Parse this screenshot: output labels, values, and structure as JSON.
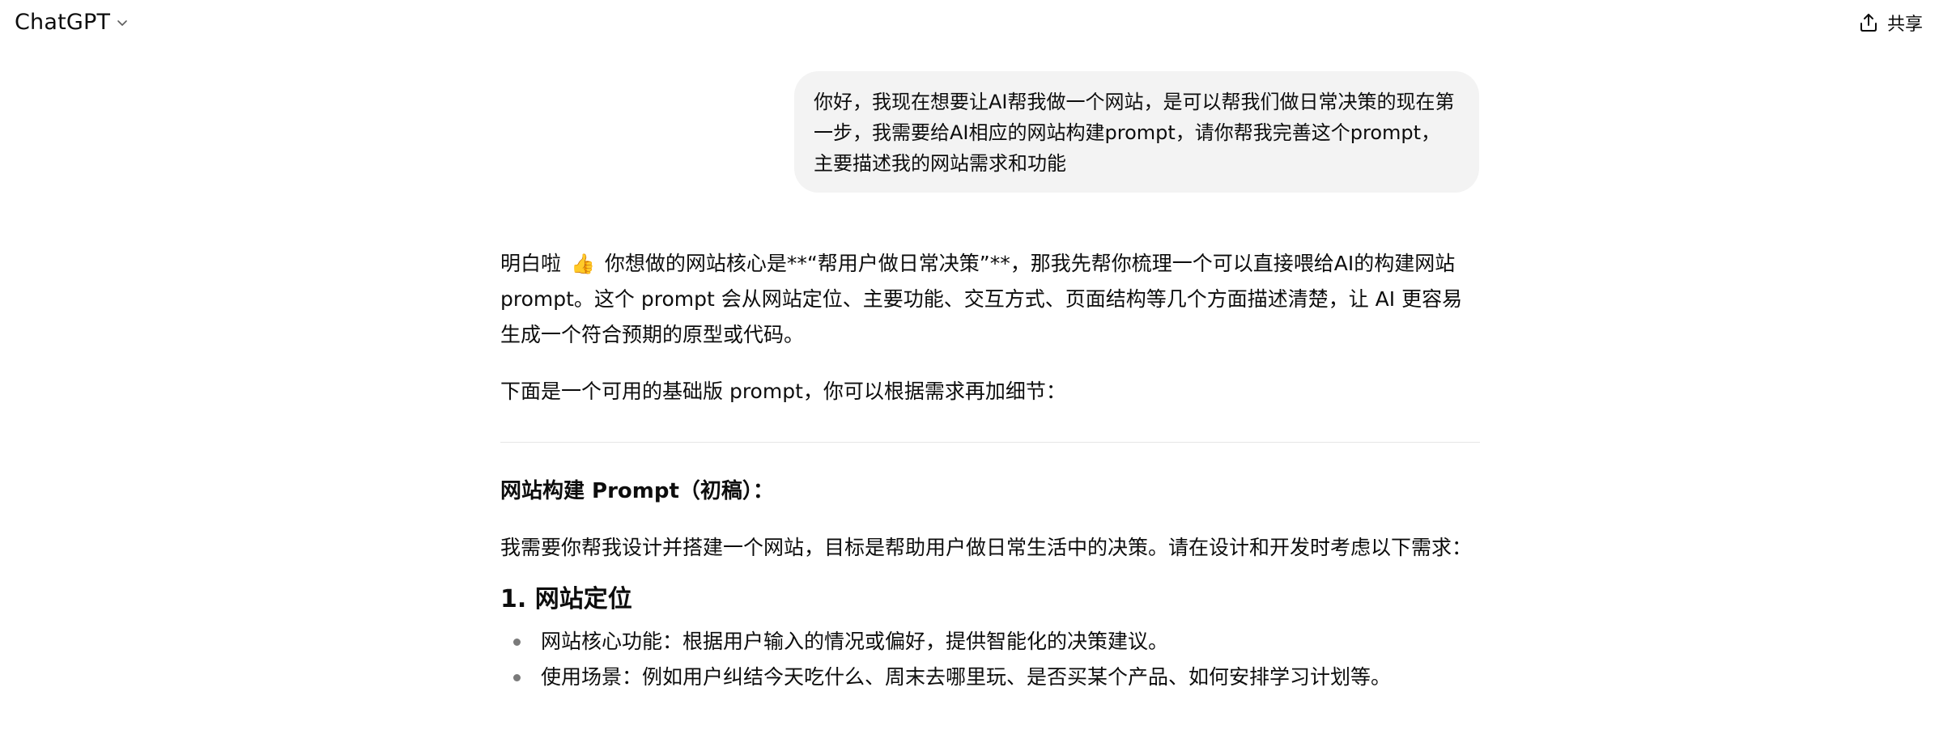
{
  "header": {
    "model_name": "ChatGPT",
    "share_label": "共享"
  },
  "user_message": {
    "text": "你好，我现在想要让AI帮我做一个网站，是可以帮我们做日常决策的现在第一步，我需要给AI相应的网站构建prompt，请你帮我完善这个prompt，主要描述我的网站需求和功能"
  },
  "assistant_message": {
    "intro_before_emoji": "明白啦",
    "emoji": "👍",
    "intro_after_emoji": "你想做的网站核心是**“帮用户做日常决策”**，那我先帮你梳理一个可以直接喂给AI的构建网站 prompt。这个 prompt 会从网站定位、主要功能、交互方式、页面结构等几个方面描述清楚，让 AI 更容易生成一个符合预期的原型或代码。",
    "lead": "下面是一个可用的基础版 prompt，你可以根据需求再加细节：",
    "prompt_title": "网站构建 Prompt（初稿）：",
    "prompt_intro": "我需要你帮我设计并搭建一个网站，目标是帮助用户做日常生活中的决策。请在设计和开发时考虑以下需求：",
    "section_1": {
      "heading": "1. 网站定位",
      "bullets": [
        "网站核心功能：根据用户输入的情况或偏好，提供智能化的决策建议。",
        "使用场景：例如用户纠结今天吃什么、周末去哪里玩、是否买某个产品、如何安排学习计划等。"
      ]
    }
  }
}
